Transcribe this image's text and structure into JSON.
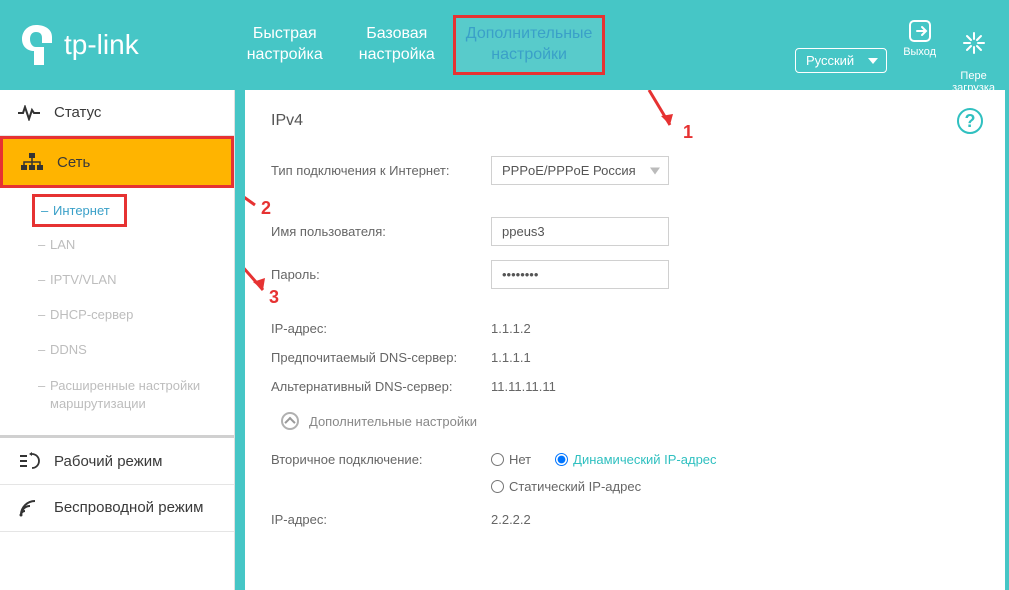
{
  "header": {
    "brand": "tp-link",
    "tabs": {
      "quick": "Быстрая\nнастройка",
      "basic": "Базовая\nнастройка",
      "advanced": "Дополнительные\nнастройки"
    },
    "language": "Русский",
    "logout": "Выход",
    "reboot": "Пере\nзагрузка"
  },
  "sidebar": {
    "status": "Статус",
    "network": "Сеть",
    "net_items": {
      "internet": "Интернет",
      "lan": "LAN",
      "iptv": "IPTV/VLAN",
      "dhcp": "DHCP-сервер",
      "ddns": "DDNS",
      "routing": "Расширенные настройки маршрутизации"
    },
    "opmode": "Рабочий режим",
    "wireless": "Беспроводной режим"
  },
  "content": {
    "title": "IPv4",
    "conn_type_label": "Тип подключения к Интернет:",
    "conn_type_value": "PPPoE/PPPoE Россия",
    "user_label": "Имя пользователя:",
    "user_value": "ppeus3",
    "pass_label": "Пароль:",
    "pass_value": "••••••••",
    "ip_label": "IP-адрес:",
    "ip_value": "1.1.1.2",
    "dns1_label": "Предпочитаемый DNS-сервер:",
    "dns1_value": "1.1.1.1",
    "dns2_label": "Альтернативный DNS-сервер:",
    "dns2_value": "11.11.11.11",
    "expand": "Дополнительные настройки",
    "sec_conn_label": "Вторичное подключение:",
    "sec_none": "Нет",
    "sec_dyn": "Динамический IP-адрес",
    "sec_static": "Статический IP-адрес",
    "sec_ip_label": "IP-адрес:",
    "sec_ip_value": "2.2.2.2"
  },
  "annotations": {
    "a1": "1",
    "a2": "2",
    "a3": "3"
  }
}
